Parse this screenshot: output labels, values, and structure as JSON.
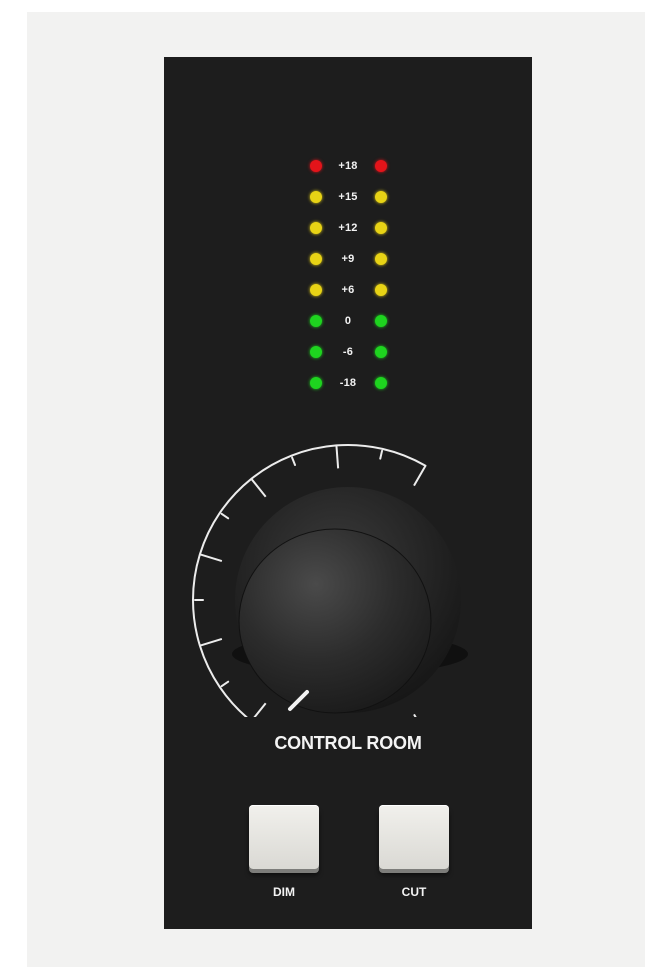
{
  "meter": {
    "rows": [
      {
        "label": "+18",
        "color": "#e3141a"
      },
      {
        "label": "+15",
        "color": "#e8d315"
      },
      {
        "label": "+12",
        "color": "#e8d315"
      },
      {
        "label": "+9",
        "color": "#e8d315"
      },
      {
        "label": "+6",
        "color": "#e8d315"
      },
      {
        "label": "0",
        "color": "#1ed41f"
      },
      {
        "label": "-6",
        "color": "#1ed41f"
      },
      {
        "label": "-18",
        "color": "#1ed41f"
      }
    ]
  },
  "section_title": "CONTROL ROOM",
  "buttons": {
    "dim_label": "DIM",
    "cut_label": "CUT"
  },
  "colors": {
    "panel": "#1d1d1d",
    "led_red": "#e3141a",
    "led_yellow": "#e8d315",
    "led_green": "#1ed41f",
    "button_face": "#e9e8e3"
  }
}
